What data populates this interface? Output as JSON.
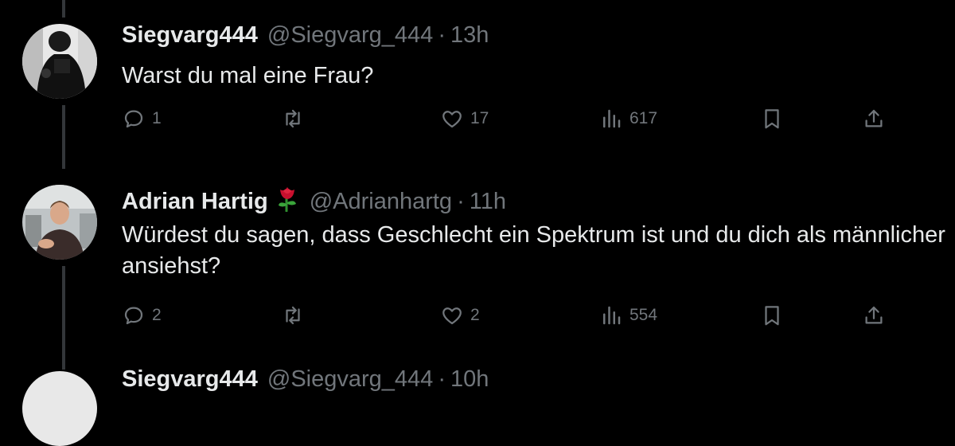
{
  "tweets": [
    {
      "name": "Siegvarg444",
      "handle": "@Siegvarg_444",
      "dot": "·",
      "time": "13h",
      "text": "Warst du mal eine Frau?",
      "stats": {
        "replies": "1",
        "retweets": "",
        "likes": "17",
        "views": "617"
      }
    },
    {
      "name": "Adrian Hartig",
      "emoji": "rose",
      "handle": "@Adrianhartg",
      "dot": "·",
      "time": "11h",
      "text": "Würdest du sagen, dass Geschlecht ein Spektrum ist und du dich als männlicher ansiehst?",
      "stats": {
        "replies": "2",
        "retweets": "",
        "likes": "2",
        "views": "554"
      }
    },
    {
      "name": "Siegvarg444",
      "handle": "@Siegvarg_444",
      "dot": "·",
      "time": "10h"
    }
  ],
  "icons": [
    "reply-icon",
    "retweet-icon",
    "like-icon",
    "views-icon",
    "bookmark-icon",
    "share-icon"
  ],
  "colors": {
    "background": "#000000",
    "text": "#e7e9ea",
    "muted": "#71767b",
    "thread_line": "#333639"
  }
}
